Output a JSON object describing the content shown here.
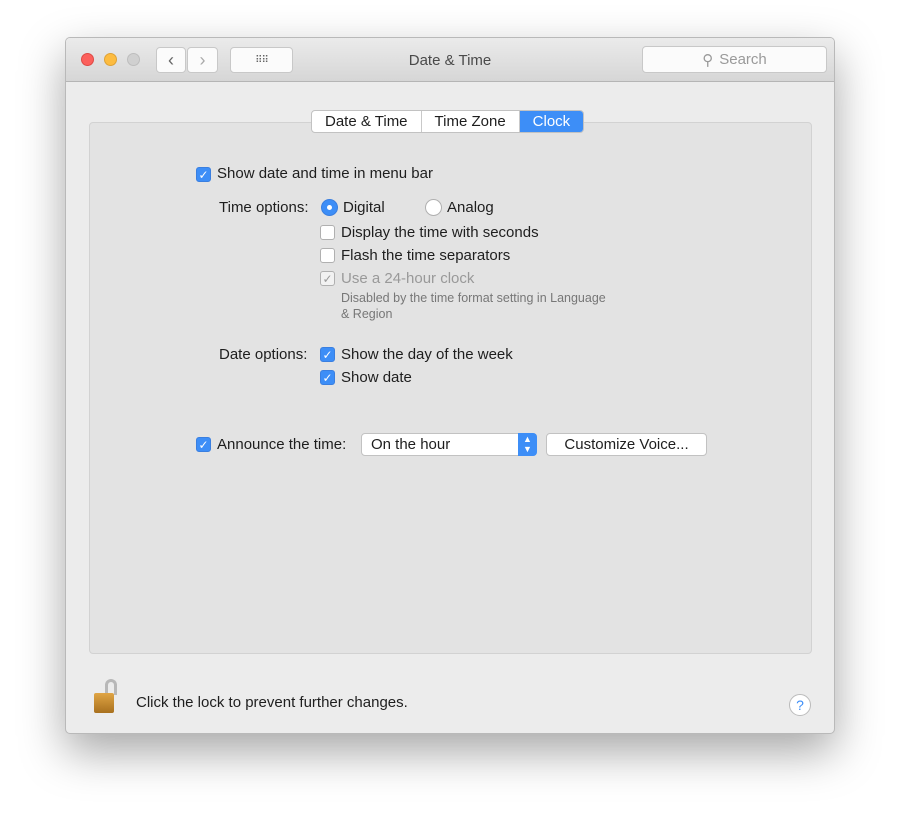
{
  "window": {
    "title": "Date & Time",
    "search_placeholder": "Search"
  },
  "tabs": [
    {
      "label": "Date & Time",
      "selected": false
    },
    {
      "label": "Time Zone",
      "selected": false
    },
    {
      "label": "Clock",
      "selected": true
    }
  ],
  "clock": {
    "show_in_menu_bar": {
      "label": "Show date and time in menu bar",
      "checked": true
    },
    "time_options_label": "Time options:",
    "digital": {
      "label": "Digital",
      "selected": true
    },
    "analog": {
      "label": "Analog",
      "selected": false
    },
    "seconds": {
      "label": "Display the time with seconds",
      "checked": false
    },
    "flash": {
      "label": "Flash the time separators",
      "checked": false
    },
    "hour24": {
      "label": "Use a 24-hour clock",
      "checked": true,
      "disabled": true
    },
    "hour24_note": "Disabled by the time format setting in Language",
    "hour24_note2": "& Region",
    "date_options_label": "Date options:",
    "day_of_week": {
      "label": "Show the day of the week",
      "checked": true
    },
    "show_date": {
      "label": "Show date",
      "checked": true
    },
    "announce": {
      "label": "Announce the time:",
      "checked": true
    },
    "announce_value": "On the hour",
    "customize_voice": "Customize Voice..."
  },
  "footer": {
    "lock_text": "Click the lock to prevent further changes.",
    "help": "?"
  },
  "colors": {
    "accent": "#3d8ef7",
    "close": "#fc605c",
    "minimize": "#fdbc40"
  }
}
